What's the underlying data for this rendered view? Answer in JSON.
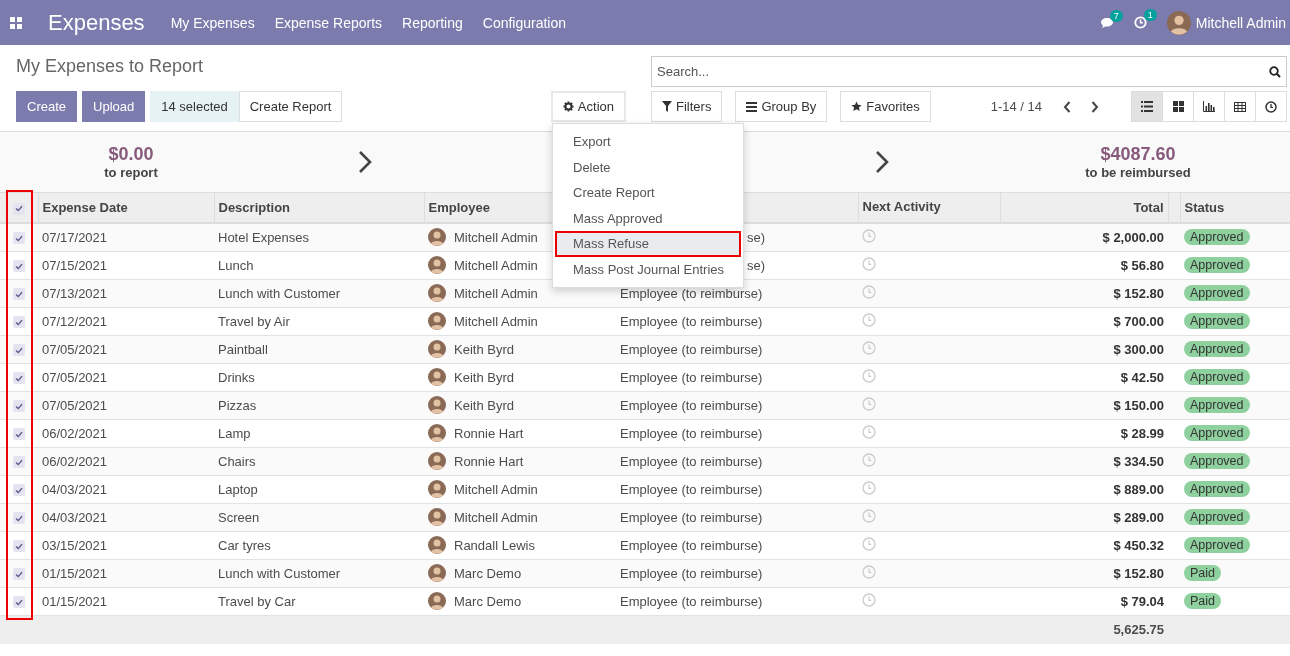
{
  "app": {
    "name": "Expenses",
    "menu": [
      "My Expenses",
      "Expense Reports",
      "Reporting",
      "Configuration"
    ],
    "messages_badge": "7",
    "activities_badge": "1",
    "user": "Mitchell Admin"
  },
  "control_panel": {
    "title": "My Expenses to Report",
    "create": "Create",
    "upload": "Upload",
    "selected_count": "14 selected",
    "create_report": "Create Report",
    "action": "Action",
    "search": {
      "placeholder": "Search..."
    },
    "filters": "Filters",
    "group_by": "Group By",
    "favorites": "Favorites",
    "pager": "1-14 / 14",
    "views": [
      {
        "kind": "list",
        "selected": true
      },
      {
        "kind": "kanban",
        "selected": false
      },
      {
        "kind": "graph",
        "selected": false
      },
      {
        "kind": "pivot",
        "selected": false
      },
      {
        "kind": "activity",
        "selected": false
      }
    ]
  },
  "action_menu": {
    "items": [
      {
        "label": "Export",
        "selected": false
      },
      {
        "label": "Delete",
        "selected": false
      },
      {
        "label": "Create Report",
        "selected": false
      },
      {
        "label": "Mass Approved",
        "selected": false
      },
      {
        "label": "Mass Refuse",
        "selected": true
      },
      {
        "label": "Mass Post Journal Entries",
        "selected": false
      }
    ]
  },
  "summary": [
    {
      "amount": "$0.00",
      "label": "to report"
    },
    {
      "amount": "$4087.60",
      "label": "to be reimbursed"
    }
  ],
  "table": {
    "select_column_highlighted": true,
    "all_checked": true,
    "columns": [
      "Expense Date",
      "Description",
      "Employee",
      "Next Activity",
      "Total",
      "Status"
    ],
    "rows": [
      {
        "checked": true,
        "date": "07/17/2021",
        "description": "Hotel Expenses",
        "employee": "Mitchell Admin",
        "paid_by": "se)",
        "paid_by_clipped": true,
        "total": "$ 2,000.00",
        "status": "Approved"
      },
      {
        "checked": true,
        "date": "07/15/2021",
        "description": "Lunch",
        "employee": "Mitchell Admin",
        "paid_by": "se)",
        "paid_by_clipped": true,
        "total": "$ 56.80",
        "status": "Approved"
      },
      {
        "checked": true,
        "date": "07/13/2021",
        "description": "Lunch with Customer",
        "employee": "Mitchell Admin",
        "paid_by": "Employee (to reimburse)",
        "paid_by_clipped": false,
        "total": "$ 152.80",
        "status": "Approved"
      },
      {
        "checked": true,
        "date": "07/12/2021",
        "description": "Travel by Air",
        "employee": "Mitchell Admin",
        "paid_by": "Employee (to reimburse)",
        "paid_by_clipped": false,
        "total": "$ 700.00",
        "status": "Approved"
      },
      {
        "checked": true,
        "date": "07/05/2021",
        "description": "Paintball",
        "employee": "Keith Byrd",
        "paid_by": "Employee (to reimburse)",
        "paid_by_clipped": false,
        "total": "$ 300.00",
        "status": "Approved"
      },
      {
        "checked": true,
        "date": "07/05/2021",
        "description": "Drinks",
        "employee": "Keith Byrd",
        "paid_by": "Employee (to reimburse)",
        "paid_by_clipped": false,
        "total": "$ 42.50",
        "status": "Approved"
      },
      {
        "checked": true,
        "date": "07/05/2021",
        "description": "Pizzas",
        "employee": "Keith Byrd",
        "paid_by": "Employee (to reimburse)",
        "paid_by_clipped": false,
        "total": "$ 150.00",
        "status": "Approved"
      },
      {
        "checked": true,
        "date": "06/02/2021",
        "description": "Lamp",
        "employee": "Ronnie Hart",
        "paid_by": "Employee (to reimburse)",
        "paid_by_clipped": false,
        "total": "$ 28.99",
        "status": "Approved"
      },
      {
        "checked": true,
        "date": "06/02/2021",
        "description": "Chairs",
        "employee": "Ronnie Hart",
        "paid_by": "Employee (to reimburse)",
        "paid_by_clipped": false,
        "total": "$ 334.50",
        "status": "Approved"
      },
      {
        "checked": true,
        "date": "04/03/2021",
        "description": "Laptop",
        "employee": "Mitchell Admin",
        "paid_by": "Employee (to reimburse)",
        "paid_by_clipped": false,
        "total": "$ 889.00",
        "status": "Approved"
      },
      {
        "checked": true,
        "date": "04/03/2021",
        "description": "Screen",
        "employee": "Mitchell Admin",
        "paid_by": "Employee (to reimburse)",
        "paid_by_clipped": false,
        "total": "$ 289.00",
        "status": "Approved"
      },
      {
        "checked": true,
        "date": "03/15/2021",
        "description": "Car tyres",
        "employee": "Randall Lewis",
        "paid_by": "Employee (to reimburse)",
        "paid_by_clipped": false,
        "total": "$ 450.32",
        "status": "Approved"
      },
      {
        "checked": true,
        "date": "01/15/2021",
        "description": "Lunch with Customer",
        "employee": "Marc Demo",
        "paid_by": "Employee (to reimburse)",
        "paid_by_clipped": false,
        "total": "$ 152.80",
        "status": "Paid"
      },
      {
        "checked": true,
        "date": "01/15/2021",
        "description": "Travel by Car",
        "employee": "Marc Demo",
        "paid_by": "Employee (to reimburse)",
        "paid_by_clipped": false,
        "total": "$ 79.04",
        "status": "Paid"
      }
    ],
    "footer_total": "5,625.75"
  }
}
